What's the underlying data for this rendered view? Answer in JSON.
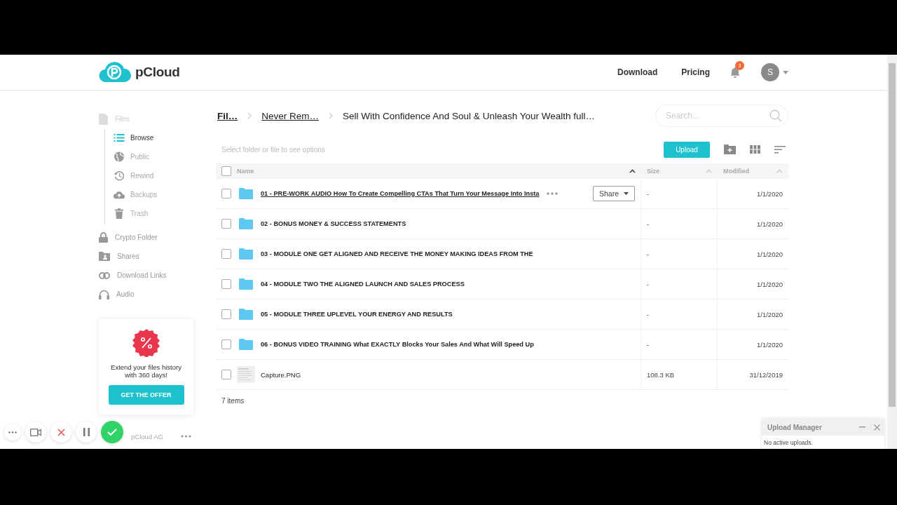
{
  "header": {
    "logo": "pCloud",
    "nav": [
      "Download",
      "Pricing"
    ],
    "notification_count": "3",
    "avatar": "S"
  },
  "sidebar": {
    "items": [
      {
        "label": "Files",
        "selected": false,
        "children": [
          {
            "label": "Browse",
            "selected": true
          },
          {
            "label": "Public",
            "selected": false
          },
          {
            "label": "Rewind",
            "selected": false
          },
          {
            "label": "Backups",
            "selected": false
          },
          {
            "label": "Trash",
            "selected": false
          }
        ]
      },
      {
        "label": "Crypto Folder",
        "selected": false
      },
      {
        "label": "Shares",
        "selected": false
      },
      {
        "label": "Download Links",
        "selected": false
      },
      {
        "label": "Audio",
        "selected": false
      }
    ],
    "promo": {
      "text": "Extend your files history with 360 days!",
      "button": "GET THE OFFER"
    },
    "footer": "pCloud AG"
  },
  "breadcrumb": [
    {
      "label": "Fil…",
      "link": true
    },
    {
      "label": "Never Rem…",
      "link": true
    },
    {
      "label": "Sell With Confidence And Soul & Unleash Your Wealth full…",
      "link": false
    }
  ],
  "search": {
    "placeholder": "Search..."
  },
  "toolbar": {
    "hint": "Select folder or file to see options",
    "upload": "Upload"
  },
  "table": {
    "select_all": {
      "checked": false
    },
    "columns": [
      {
        "label": "Name",
        "sorted": true
      },
      {
        "label": "Size",
        "sorted": false
      },
      {
        "label": "Modified",
        "sorted": false
      }
    ],
    "rows": [
      {
        "kind": "folder",
        "name": "01 - PRE-WORK AUDIO How To Create Compelling CTAs That Turn Your Message Into Insta",
        "size": "-",
        "modified": "1/1/2020",
        "checked": false,
        "hovered": true
      },
      {
        "kind": "folder",
        "name": "02 - BONUS MONEY & SUCCESS STATEMENTS",
        "size": "-",
        "modified": "1/1/2020",
        "checked": false,
        "hovered": false
      },
      {
        "kind": "folder",
        "name": "03 - MODULE ONE GET ALIGNED AND RECEIVE THE MONEY MAKING IDEAS FROM THE",
        "size": "-",
        "modified": "1/1/2020",
        "checked": false,
        "hovered": false
      },
      {
        "kind": "folder",
        "name": "04 - MODULE TWO THE ALIGNED LAUNCH AND SALES PROCESS",
        "size": "-",
        "modified": "1/1/2020",
        "checked": false,
        "hovered": false
      },
      {
        "kind": "folder",
        "name": "05 - MODULE THREE UPLEVEL YOUR ENERGY AND RESULTS",
        "size": "-",
        "modified": "1/1/2020",
        "checked": false,
        "hovered": false
      },
      {
        "kind": "folder",
        "name": "06 - BONUS VIDEO TRAINING What EXACTLY Blocks Your Sales And What Will Speed Up",
        "size": "-",
        "modified": "1/1/2020",
        "checked": false,
        "hovered": false
      },
      {
        "kind": "file",
        "name": "Capture.PNG",
        "size": "108.3 KB",
        "modified": "31/12/2019",
        "checked": false,
        "hovered": false
      }
    ],
    "share": "Share",
    "count": "7 items"
  },
  "upload_manager": {
    "title": "Upload Manager",
    "status": "No active uploads."
  }
}
